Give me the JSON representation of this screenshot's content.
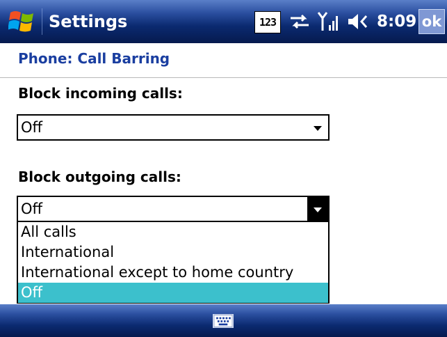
{
  "window": {
    "title": "Settings",
    "ok_label": "ok"
  },
  "status": {
    "input_mode": "123",
    "time": "8:09",
    "icons": [
      "windows-start-icon",
      "input-mode-icon",
      "connectivity-icon",
      "signal-icon",
      "volume-icon"
    ]
  },
  "page": {
    "header": "Phone: Call Barring"
  },
  "incoming": {
    "label": "Block incoming calls:",
    "value": "Off"
  },
  "outgoing": {
    "label": "Block outgoing calls:",
    "value": "Off",
    "options": [
      "All calls",
      "International",
      "International except to home country",
      "Off"
    ],
    "selected_index": 3
  },
  "bottom": {
    "icons": [
      "keyboard-icon"
    ]
  },
  "colors": {
    "accent": "#1a3ea0",
    "selection": "#3cc0cc",
    "bar_dark": "#061a4e"
  }
}
